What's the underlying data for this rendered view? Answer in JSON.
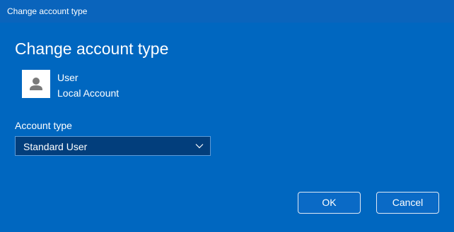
{
  "window": {
    "title": "Change account type"
  },
  "dialog": {
    "heading": "Change account type",
    "user": {
      "name": "User",
      "account_kind": "Local Account",
      "avatar_icon": "person-icon"
    },
    "account_type": {
      "label": "Account type",
      "selected": "Standard User",
      "chevron_icon": "chevron-down-icon"
    },
    "buttons": {
      "ok": "OK",
      "cancel": "Cancel"
    }
  },
  "colors": {
    "background": "#0067c0",
    "titlebar": "#0a64bc",
    "select_background": "#023e7c",
    "select_border": "#5d9ad6",
    "text": "#ffffff"
  }
}
